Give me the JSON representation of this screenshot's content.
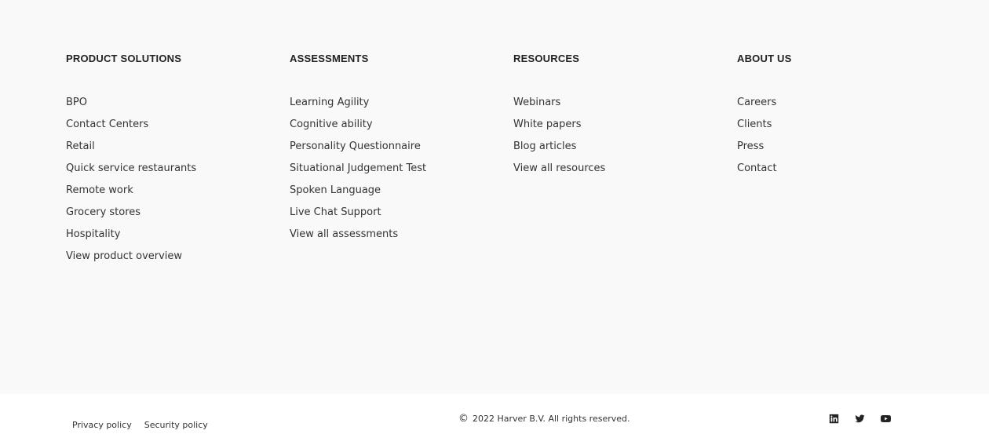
{
  "footer": {
    "columns": [
      {
        "heading": "PRODUCT SOLUTIONS",
        "links": [
          "BPO",
          "Contact Centers",
          "Retail",
          "Quick service restaurants",
          "Remote work",
          "Grocery stores",
          "Hospitality",
          "View product overview"
        ]
      },
      {
        "heading": "ASSESSMENTS",
        "links": [
          "Learning Agility",
          "Cognitive ability",
          "Personality Questionnaire",
          "Situational Judgement Test",
          "Spoken Language",
          "Live Chat Support",
          "View all assessments"
        ]
      },
      {
        "heading": "RESOURCES",
        "links": [
          "Webinars",
          "White papers",
          "Blog articles",
          "View all resources"
        ]
      },
      {
        "heading": "ABOUT US",
        "links": [
          "Careers",
          "Clients",
          "Press",
          "Contact"
        ]
      }
    ],
    "bottom": {
      "legal_links": [
        "Privacy policy",
        "Security policy"
      ],
      "copyright_symbol": "©",
      "copyright_text": "2022 Harver B.V. All rights reserved.",
      "social_icons": [
        "linkedin-icon",
        "twitter-icon",
        "youtube-icon"
      ]
    },
    "colors": {
      "top_background": "#f9f9f9",
      "bottom_background": "#ffffff",
      "text": "#333333",
      "heading": "#222222"
    }
  }
}
